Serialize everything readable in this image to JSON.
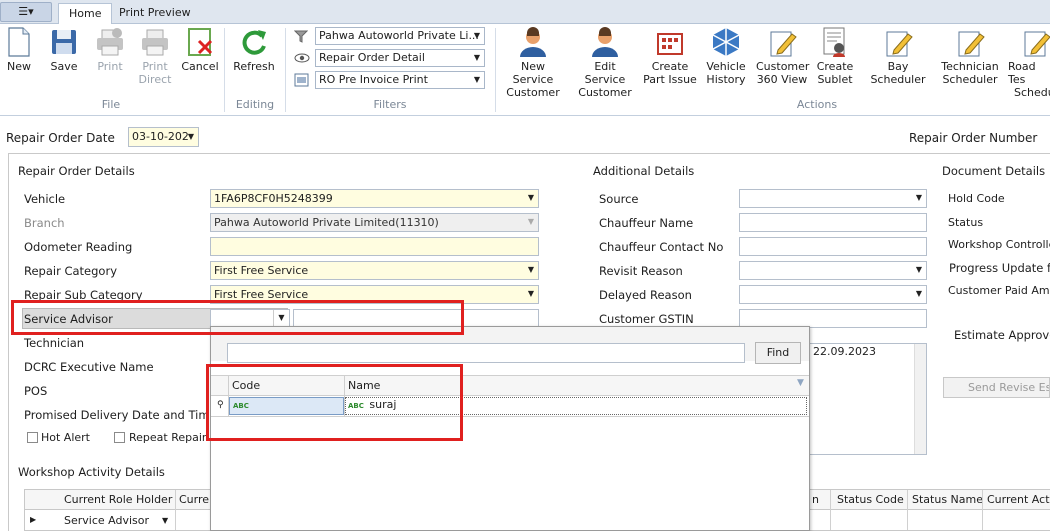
{
  "tabs": {
    "app_menu": "☰▾",
    "home": "Home",
    "print_preview": "Print Preview"
  },
  "ribbon": {
    "file": {
      "new": "New",
      "save": "Save",
      "print": "Print",
      "print_direct_1": "Print",
      "print_direct_2": "Direct",
      "cancel": "Cancel",
      "group": "File"
    },
    "editing": {
      "refresh": "Refresh",
      "group": "Editing"
    },
    "filters": {
      "f1": "Pahwa Autoworld Private Li...",
      "f2": "Repair Order Detail",
      "f3": "RO Pre Invoice Print",
      "group": "Filters"
    },
    "actions": {
      "new_service_1": "New Service",
      "new_service_2": "Customer",
      "edit_service_1": "Edit Service",
      "edit_service_2": "Customer",
      "create_part_1": "Create",
      "create_part_2": "Part Issue",
      "vehicle_hist_1": "Vehicle",
      "vehicle_hist_2": "History",
      "cust360_1": "Customer",
      "cust360_2": "360 View",
      "sublet_1": "Create",
      "sublet_2": "Sublet",
      "bay": "Bay Scheduler",
      "tech_1": "Technician",
      "tech_2": "Scheduler",
      "road_1": "Road Tes",
      "road_2": "Schedu",
      "group": "Actions"
    }
  },
  "header": {
    "ro_date_label": "Repair Order Date",
    "ro_date_value": "03-10-202",
    "ro_number_label": "Repair Order Number"
  },
  "repair_details": {
    "title": "Repair Order Details",
    "vehicle_label": "Vehicle",
    "vehicle_value": "1FA6P8CF0H5248399",
    "branch_label": "Branch",
    "branch_value": "Pahwa Autoworld Private Limited(11310)",
    "odometer_label": "Odometer Reading",
    "repair_category_label": "Repair Category",
    "repair_category_value": "First Free Service",
    "repair_sub_label": "Repair Sub Category",
    "repair_sub_value": "First Free Service",
    "service_advisor_label": "Service Advisor",
    "technician_label": "Technician",
    "dcrc_label": "DCRC Executive Name",
    "pos_label": "POS",
    "promised_label": "Promised Delivery Date and Time",
    "hot_alert": "Hot Alert",
    "repeat_repair": "Repeat Repair"
  },
  "additional": {
    "title": "Additional Details",
    "source": "Source",
    "chauffeur_name": "Chauffeur Name",
    "chauffeur_contact": "Chauffeur Contact No",
    "revisit": "Revisit Reason",
    "delayed": "Delayed Reason",
    "gstin": "Customer GSTIN",
    "memo_date": "22.09.2023"
  },
  "document": {
    "title": "Document Details",
    "hold_code": "Hold Code",
    "status": "Status",
    "workshop_controller": "Workshop Controller",
    "progress": "Progress Update fo",
    "paid_amount": "Customer Paid Amour",
    "estimate": "Estimate Approve",
    "send_revise": "Send Revise Esti"
  },
  "lookup": {
    "find": "Find",
    "col_code": "Code",
    "col_name": "Name",
    "filter_icon_text": "ABC",
    "filter_value": "suraj"
  },
  "workshop": {
    "title": "Workshop Activity Details",
    "cols": [
      "Current Role Holder",
      "Curren",
      "n",
      "Status Code",
      "Status Name",
      "Current Acti..."
    ],
    "row_value": "Service Advisor"
  }
}
